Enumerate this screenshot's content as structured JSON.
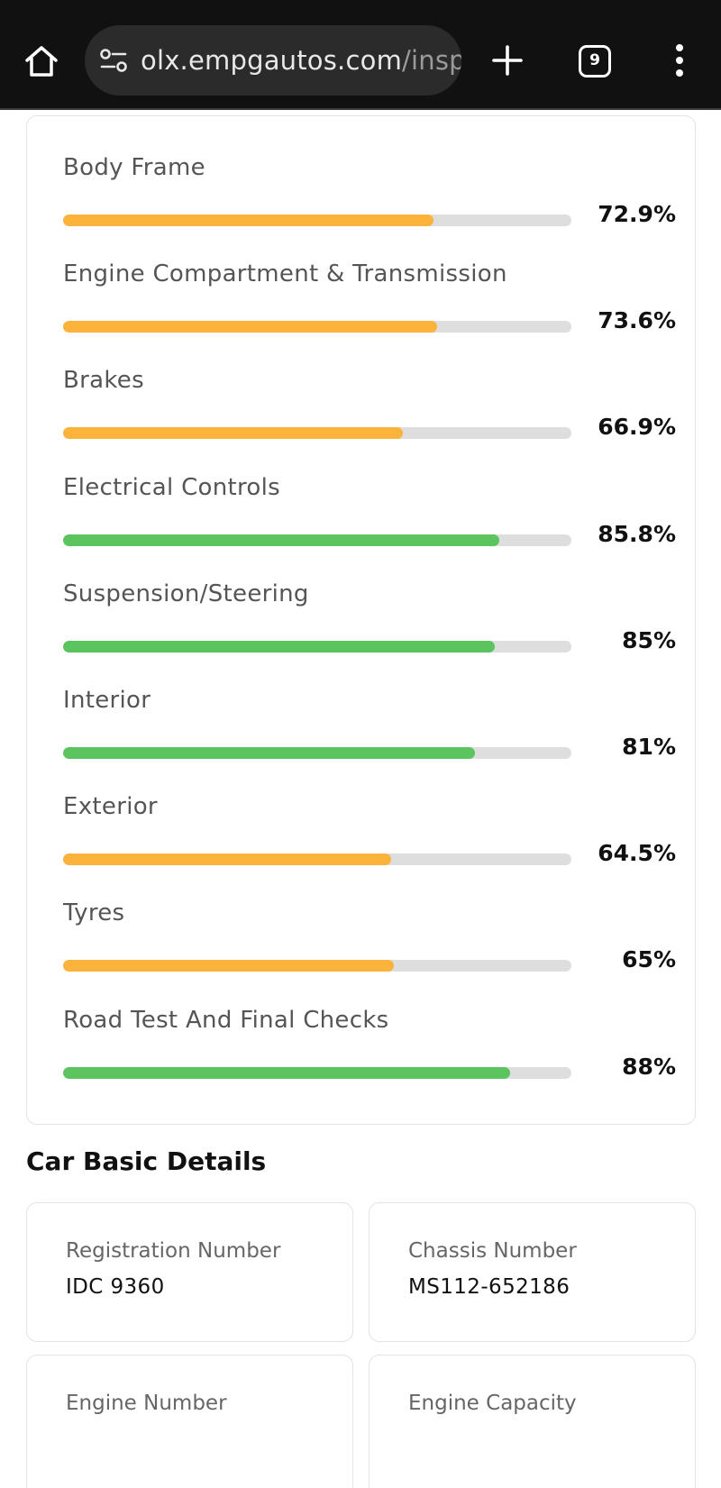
{
  "browser": {
    "url_domain": "olx.empgautos.com",
    "url_path": "/insp",
    "tab_count": "9"
  },
  "colors": {
    "good": "#5cc45e",
    "fair": "#fbb33b",
    "track": "#dedede"
  },
  "inspection": {
    "items": [
      {
        "label": "Body Frame",
        "value": "72.9%",
        "percent": 72.9,
        "status": "fair"
      },
      {
        "label": "Engine Compartment & Transmission",
        "value": "73.6%",
        "percent": 73.6,
        "status": "fair"
      },
      {
        "label": "Brakes",
        "value": "66.9%",
        "percent": 66.9,
        "status": "fair"
      },
      {
        "label": "Electrical Controls",
        "value": "85.8%",
        "percent": 85.8,
        "status": "good"
      },
      {
        "label": "Suspension/Steering",
        "value": "85%",
        "percent": 85,
        "status": "good"
      },
      {
        "label": "Interior",
        "value": "81%",
        "percent": 81,
        "status": "good"
      },
      {
        "label": "Exterior",
        "value": "64.5%",
        "percent": 64.5,
        "status": "fair"
      },
      {
        "label": "Tyres",
        "value": "65%",
        "percent": 65,
        "status": "fair"
      },
      {
        "label": "Road Test And Final Checks",
        "value": "88%",
        "percent": 88,
        "status": "good"
      }
    ]
  },
  "basic_details": {
    "title": "Car Basic Details",
    "cards": [
      {
        "label": "Registration Number",
        "value": "IDC 9360"
      },
      {
        "label": "Chassis Number",
        "value": "MS112-652186"
      },
      {
        "label": "Engine Number",
        "value": ""
      },
      {
        "label": "Engine Capacity",
        "value": ""
      }
    ]
  }
}
